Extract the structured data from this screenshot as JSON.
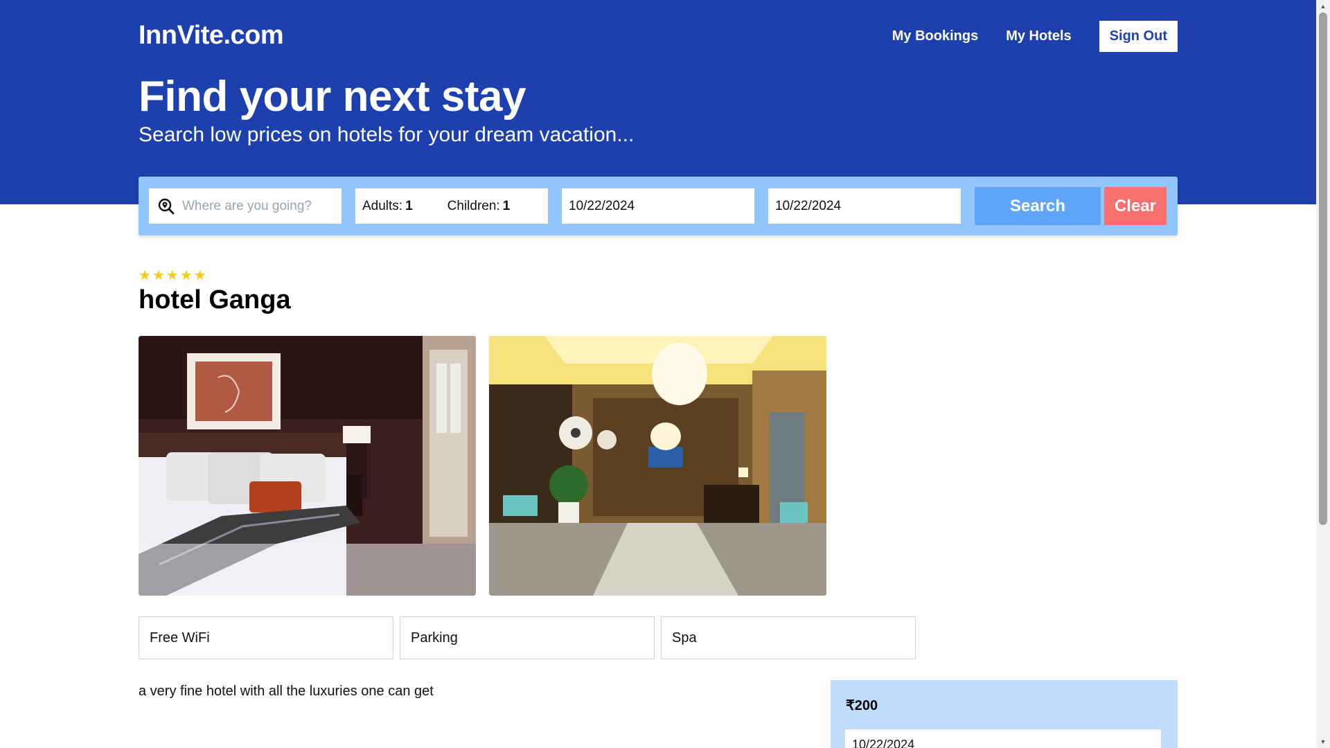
{
  "header": {
    "brand": "InnVite.com",
    "nav": {
      "my_bookings": "My Bookings",
      "my_hotels": "My Hotels",
      "sign_out": "Sign Out"
    },
    "title": "Find your next stay",
    "subtitle": "Search low prices on hotels for your dream vacation..."
  },
  "search": {
    "destination_placeholder": "Where are you going?",
    "destination_value": "",
    "adults_label": "Adults:",
    "adults_value": "1",
    "children_label": "Children:",
    "children_value": "1",
    "check_in": "10/22/2024",
    "check_out": "10/22/2024",
    "search_label": "Search",
    "clear_label": "Clear"
  },
  "hotel": {
    "star_rating": 5,
    "name": "hotel Ganga",
    "images": [
      "hotel-bedroom",
      "hotel-lobby"
    ],
    "facilities": [
      "Free WiFi",
      "Parking",
      "Spa"
    ],
    "description": "a very fine hotel with all the luxuries one can get"
  },
  "booking": {
    "price": "₹200",
    "date": "10/22/2024"
  },
  "colors": {
    "header_bg": "#1e40af",
    "searchbar_bg": "#93c5fd",
    "search_button": "#60a5fa",
    "clear_button": "#f87171",
    "star": "#facc15",
    "booking_panel_bg": "#bfdbfe"
  }
}
